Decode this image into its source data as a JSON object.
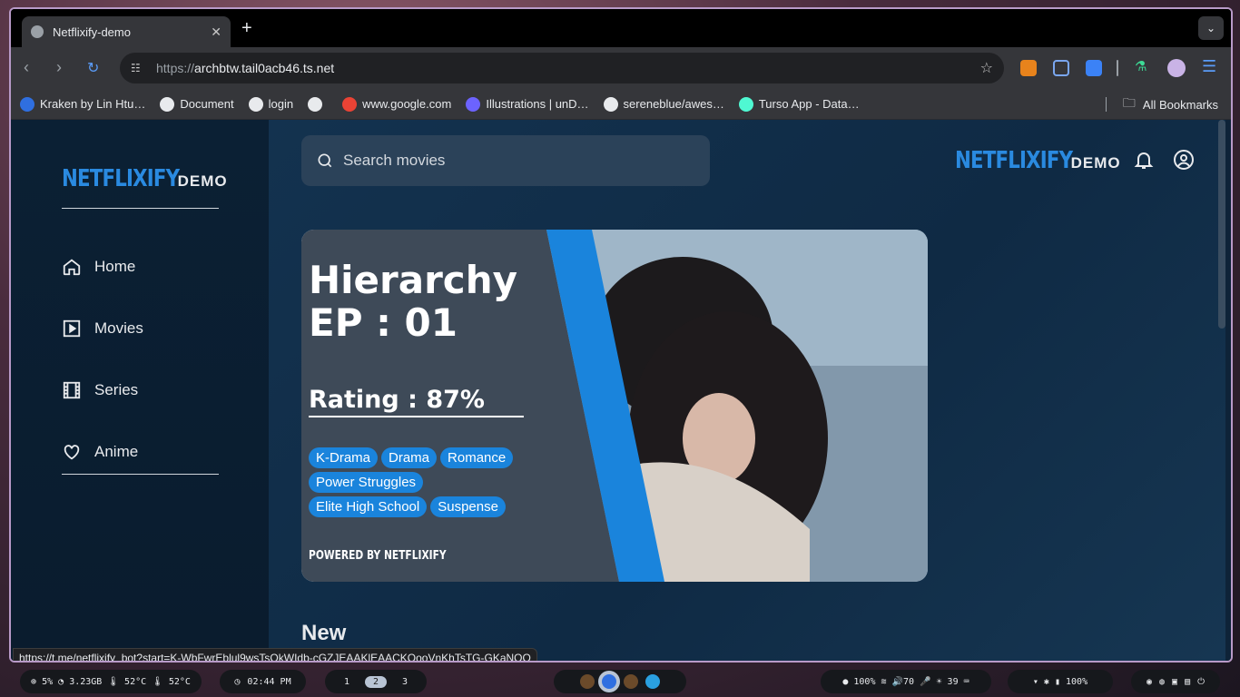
{
  "browser": {
    "tab": {
      "title": "Netflixify-demo"
    },
    "url": {
      "scheme": "https://",
      "host": "archbtw.tail0acb46.ts.net"
    },
    "bookmarks": [
      {
        "label": "Kraken by Lin Htu…",
        "color": "#2f6fe0"
      },
      {
        "label": "Document",
        "color": "#e8eaed"
      },
      {
        "label": "login",
        "color": "#e8eaed"
      },
      {
        "label": "",
        "color": "#e8eaed"
      },
      {
        "label": "www.google.com",
        "color": "#ea4335"
      },
      {
        "label": "Illustrations | unD…",
        "color": "#6c63ff"
      },
      {
        "label": "sereneblue/awes…",
        "color": "#e8eaed"
      },
      {
        "label": "Turso App - Data…",
        "color": "#4ff8d2"
      }
    ],
    "all_bookmarks": "All Bookmarks",
    "status_url": "https://t.me/netflixify_bot?start=K-WbFwrEblul9wsTsQkWIdb-cGZJEAAKlEAACKQooVnKhTsTG-GKaNQQ"
  },
  "app": {
    "logo": {
      "brand": "NETFLIXIFY",
      "suffix": "DEMO"
    },
    "menu": [
      {
        "label": "Home",
        "icon": "home-icon"
      },
      {
        "label": "Movies",
        "icon": "play-square-icon"
      },
      {
        "label": "Series",
        "icon": "film-icon"
      },
      {
        "label": "Anime",
        "icon": "heart-icon"
      }
    ],
    "search": {
      "placeholder": "Search movies"
    },
    "hero": {
      "title_line1": "Hierarchy",
      "title_line2": "EP : 01",
      "rating": "Rating : 87%",
      "tags": [
        "K-Drama",
        "Drama",
        "Romance",
        "Power Struggles",
        "Elite High School",
        "Suspense"
      ],
      "powered": "POWERED BY NETFLIXIFY"
    },
    "section_title": "New",
    "colors": {
      "accent": "#1a84dc",
      "bg": "#0f2a44"
    }
  },
  "taskbar": {
    "system": "⊕ 5%  ◔ 3.23GB  🌡 52°C  🌡 52°C",
    "clock": "02:44 PM",
    "workspaces": [
      "1",
      "2",
      "3"
    ],
    "active_workspace": "2",
    "status": "● 100%  ≋ 🔊70  🎤 ☀ 39  ⌨",
    "battery": "▾  ✱  ▮ 100%"
  }
}
